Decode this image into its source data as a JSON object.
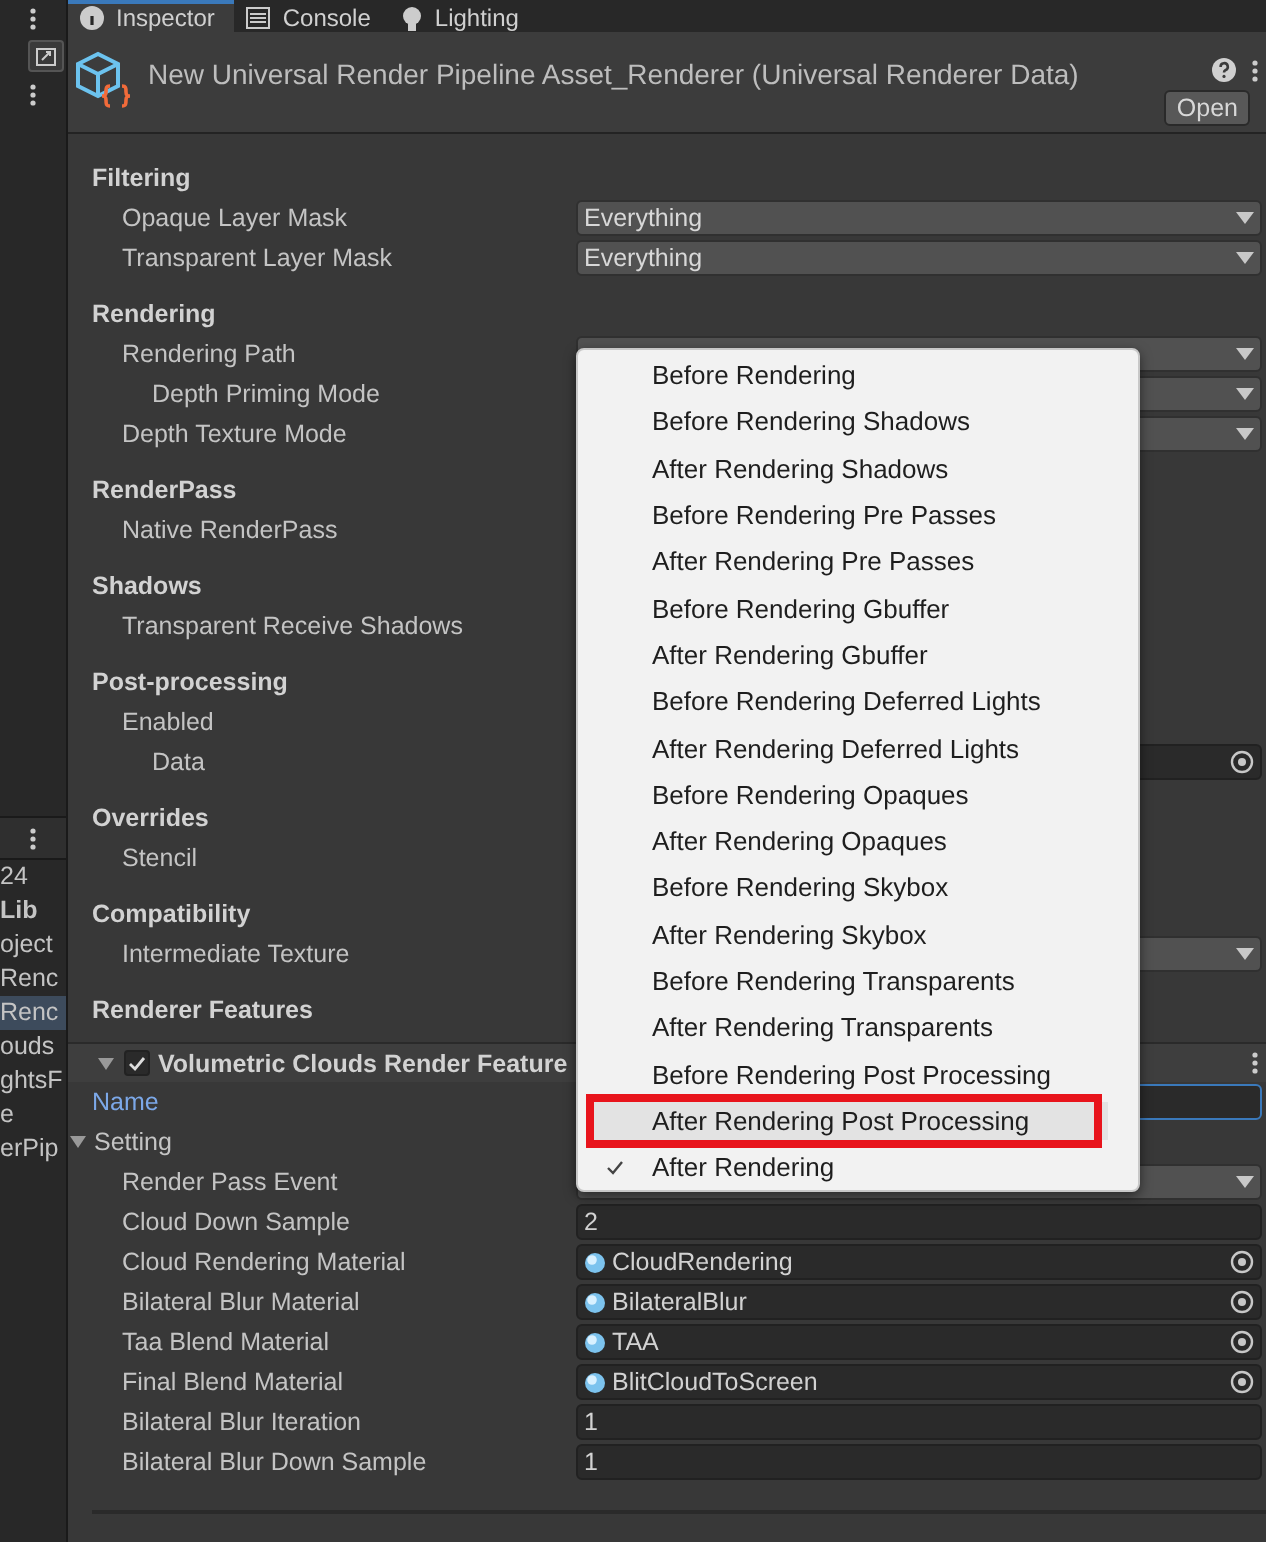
{
  "left_panel": {
    "items": [
      {
        "label": "24",
        "kind": "count"
      },
      {
        "label": "Lib",
        "kind": "folder"
      },
      {
        "label": "oject",
        "kind": "item",
        "selected": false
      },
      {
        "label": "Renc",
        "kind": "item",
        "selected": false
      },
      {
        "label": "Renc",
        "kind": "item",
        "selected": true
      },
      {
        "label": "ouds",
        "kind": "item",
        "selected": false
      },
      {
        "label": "ghtsF",
        "kind": "item",
        "selected": false
      },
      {
        "label": "e",
        "kind": "item",
        "selected": false
      },
      {
        "label": "erPip",
        "kind": "item",
        "selected": false
      }
    ]
  },
  "tabs": [
    {
      "label": "Inspector",
      "selected": true
    },
    {
      "label": "Console",
      "selected": false
    },
    {
      "label": "Lighting",
      "selected": false
    }
  ],
  "header": {
    "title": "New Universal Render Pipeline Asset_Renderer (Universal Renderer Data)",
    "button": "Open"
  },
  "sections": [
    {
      "heading": "Filtering",
      "rows": [
        {
          "label": "Opaque Layer Mask",
          "kind": "dropdown",
          "value": "Everything"
        },
        {
          "label": "Transparent Layer Mask",
          "kind": "dropdown",
          "value": "Everything"
        }
      ]
    },
    {
      "heading": "Rendering",
      "rows": [
        {
          "label": "Rendering Path",
          "kind": "dropdown",
          "children": [
            {
              "label": "Depth Priming Mode",
              "kind": "dropdown"
            }
          ]
        },
        {
          "label": "Depth Texture Mode",
          "kind": "dropdown"
        }
      ]
    },
    {
      "heading": "RenderPass",
      "rows": [
        {
          "label": "Native RenderPass",
          "kind": "none"
        }
      ]
    },
    {
      "heading": "Shadows",
      "rows": [
        {
          "label": "Transparent Receive Shadows",
          "kind": "none"
        }
      ]
    },
    {
      "heading": "Post-processing",
      "rows": [
        {
          "label": "Enabled",
          "kind": "none",
          "children": [
            {
              "label": "Data",
              "kind": "object"
            }
          ]
        }
      ]
    },
    {
      "heading": "Overrides",
      "rows": [
        {
          "label": "Stencil",
          "kind": "none"
        }
      ]
    },
    {
      "heading": "Compatibility",
      "rows": [
        {
          "label": "Intermediate Texture",
          "kind": "dropdown"
        }
      ]
    },
    {
      "heading": "Renderer Features"
    }
  ],
  "feature": {
    "title": "Volumetric Clouds Render Feature",
    "expanded": true,
    "enabled": true,
    "rows": [
      {
        "label": "Name",
        "kind": "text",
        "focused": true
      },
      {
        "label": "Setting",
        "kind": "foldout",
        "expanded": true,
        "children": [
          {
            "label": "Render Pass Event",
            "kind": "dropdown"
          },
          {
            "label": "Cloud Down Sample",
            "kind": "number",
            "value": "2"
          },
          {
            "label": "Cloud Rendering Material",
            "kind": "object",
            "value": "CloudRendering"
          },
          {
            "label": "Bilateral Blur Material",
            "kind": "object",
            "value": "BilateralBlur"
          },
          {
            "label": "Taa Blend Material",
            "kind": "object",
            "value": "TAA"
          },
          {
            "label": "Final Blend Material",
            "kind": "object",
            "value": "BlitCloudToScreen"
          },
          {
            "label": "Bilateral Blur Iteration",
            "kind": "number",
            "value": "1"
          },
          {
            "label": "Bilateral Blur Down Sample",
            "kind": "number",
            "value": "1"
          }
        ]
      }
    ]
  },
  "menu": {
    "items": [
      {
        "label": "Before Rendering",
        "checked": false,
        "hovered": false,
        "circled": false
      },
      {
        "label": "Before Rendering Shadows",
        "checked": false,
        "hovered": false,
        "circled": false
      },
      {
        "label": "After Rendering Shadows",
        "checked": false,
        "hovered": false,
        "circled": false
      },
      {
        "label": "Before Rendering Pre Passes",
        "checked": false,
        "hovered": false,
        "circled": false
      },
      {
        "label": "After Rendering Pre Passes",
        "checked": false,
        "hovered": false,
        "circled": false
      },
      {
        "label": "Before Rendering Gbuffer",
        "checked": false,
        "hovered": false,
        "circled": false
      },
      {
        "label": "After Rendering Gbuffer",
        "checked": false,
        "hovered": false,
        "circled": false
      },
      {
        "label": "Before Rendering Deferred Lights",
        "checked": false,
        "hovered": false,
        "circled": false
      },
      {
        "label": "After Rendering Deferred Lights",
        "checked": false,
        "hovered": false,
        "circled": false
      },
      {
        "label": "Before Rendering Opaques",
        "checked": false,
        "hovered": false,
        "circled": false
      },
      {
        "label": "After Rendering Opaques",
        "checked": false,
        "hovered": false,
        "circled": false
      },
      {
        "label": "Before Rendering Skybox",
        "checked": false,
        "hovered": false,
        "circled": false
      },
      {
        "label": "After Rendering Skybox",
        "checked": false,
        "hovered": false,
        "circled": false
      },
      {
        "label": "Before Rendering Transparents",
        "checked": false,
        "hovered": false,
        "circled": false
      },
      {
        "label": "After Rendering Transparents",
        "checked": false,
        "hovered": false,
        "circled": false
      },
      {
        "label": "Before Rendering Post Processing",
        "checked": false,
        "hovered": false,
        "circled": false
      },
      {
        "label": "After Rendering Post Processing",
        "checked": false,
        "hovered": true,
        "circled": true
      },
      {
        "label": "After Rendering",
        "checked": true,
        "hovered": false,
        "circled": false
      }
    ]
  }
}
